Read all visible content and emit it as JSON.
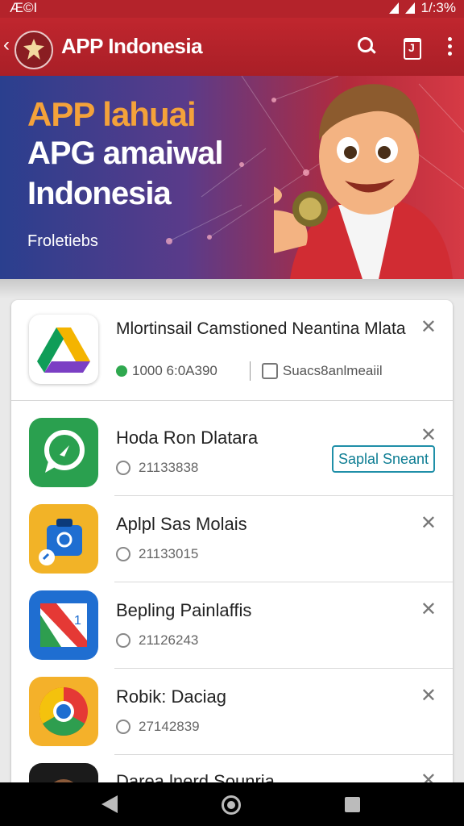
{
  "status_bar": {
    "left_text": "Æ©I",
    "time": "1/:3%"
  },
  "app_bar": {
    "back": "‹",
    "title": "APP Indonesia",
    "icons": [
      "search-icon",
      "calendar-icon",
      "more-vert-icon"
    ]
  },
  "hero": {
    "line1": "APP lahuai",
    "line2": "APG amaiwal",
    "line3": "Indonesia",
    "subtitle": "Froletiebs",
    "colors": {
      "accent": "#f4a23a",
      "left": "#2a3f8e",
      "right": "#d63a45"
    }
  },
  "featured": {
    "title": "Mlortinsail Camstioned Neantina Mlata",
    "count": "1000 6:0A390",
    "action": "Suacs8anlmeaiil",
    "close": "✕",
    "icon": "google-drive-icon"
  },
  "apps": [
    {
      "title": "Hoda Ron Dlatara",
      "count": "21133838",
      "button": "Saplal Sneant",
      "close": "✕",
      "icon": "chat-bubble-icon",
      "color": "#2aa04f"
    },
    {
      "title": "Aplpl Sas Molais",
      "count": "21133015",
      "close": "✕",
      "icon": "briefcase-icon",
      "color": "#f2b327"
    },
    {
      "title": "Bepling Painlaffis",
      "count": "21126243",
      "close": "✕",
      "icon": "calendar-app-icon",
      "color": "#1f6ed1"
    },
    {
      "title": "Robik: Daciag",
      "count": "27142839",
      "close": "✕",
      "icon": "chrome-icon",
      "color": "#f4b12a"
    },
    {
      "title": "Darea lnerd Sounria",
      "close": "✕",
      "icon": "person-photo-icon"
    }
  ],
  "nav": {
    "icons": [
      "back-icon",
      "home-icon",
      "recent-apps-icon"
    ]
  },
  "brand_color": "#b4232b"
}
